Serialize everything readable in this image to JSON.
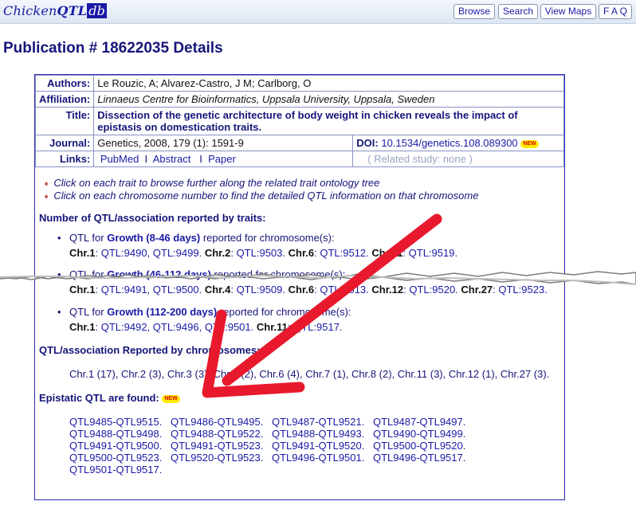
{
  "logo": {
    "part1": "Chicken",
    "part2": "QTL",
    "part3": "db"
  },
  "nav": {
    "browse": "Browse",
    "search": "Search",
    "view_maps": "View Maps",
    "faq": "F A Q"
  },
  "title": "Publication # 18622035 Details",
  "meta": {
    "authors_label": "Authors:",
    "authors": "Le Rouzic, A; Alvarez-Castro, J M; Carlborg, O",
    "affiliation_label": "Affiliation:",
    "affiliation": "Linnaeus Centre for Bioinformatics, Uppsala University, Uppsala, Sweden",
    "title_label": "Title:",
    "title_line1": "Dissection of the genetic architecture of body weight in chicken reveals the impact of",
    "title_line2": "epistasis on domestication traits.",
    "journal_label": "Journal:",
    "journal": "Genetics, 2008, 179 (1): 1591-9",
    "doi_label": "DOI:",
    "doi": "10.1534/genetics.108.089300",
    "links_label": "Links:",
    "pubmed": "PubMed",
    "abstract": "Abstract",
    "paper": "Paper",
    "sep": "I",
    "related": "( Related study: none )",
    "new": "NEW"
  },
  "notes": [
    "Click on each trait to browse further along the related trait ontology tree",
    "Click on each chromosome number to find the detailed QTL information on that chromosome"
  ],
  "traits_heading": "Number of QTL/association reported by traits:",
  "traits": [
    {
      "prefix": "QTL for ",
      "trait": "Growth (8-46 days)",
      "suffix": " reported for chromosome(s):",
      "line": [
        [
          "Chr.1",
          ": QTL:9490, QTL:9499. "
        ],
        [
          "Chr.2",
          ": QTL:9503. "
        ],
        [
          "Chr.6",
          ": QTL:9512. "
        ],
        [
          "Chr.11",
          ": QTL:9519."
        ]
      ]
    },
    {
      "prefix": "QTL for ",
      "trait": "Growth (46-112 days)",
      "suffix": " reported for chromosome(s):",
      "line": [
        [
          "Chr.1",
          ": QTL:9491, QTL:9500. "
        ],
        [
          "Chr.4",
          ": QTL:9509. "
        ],
        [
          "Chr.6",
          ": QTL:9513. "
        ],
        [
          "Chr.12",
          ": QTL:9520. "
        ],
        [
          "Chr.27",
          ": QTL:9523."
        ]
      ]
    },
    {
      "prefix": "QTL for ",
      "trait": "Growth (112-200 days)",
      "suffix": " reported for chromosome(s):",
      "line": [
        [
          "Chr.1",
          ": QTL:9492, QTL:9496, QTL:9501. "
        ],
        [
          "Chr.11",
          ": QTL:9517."
        ]
      ]
    }
  ],
  "chrom_heading": "QTL/association Reported by chromosomes:",
  "chromosomes": "Chr.1 (17), Chr.2 (3), Chr.3 (3), Chr.4 (2), Chr.6 (4), Chr.7 (1), Chr.8 (2), Chr.11 (3), Chr.12 (1), Chr.27 (3).",
  "epistatic_heading": "Epistatic QTL are found:",
  "epistatic_rows": [
    [
      "QTL9485-QTL9515.",
      "QTL9486-QTL9495.",
      "QTL9487-QTL9521.",
      "QTL9487-QTL9497."
    ],
    [
      "QTL9488-QTL9498.",
      "QTL9488-QTL9522.",
      "QTL9488-QTL9493.",
      "QTL9490-QTL9499."
    ],
    [
      "QTL9491-QTL9500.",
      "QTL9491-QTL9523.",
      "QTL9491-QTL9520.",
      "QTL9500-QTL9520."
    ],
    [
      "QTL9500-QTL9523.",
      "QTL9520-QTL9523.",
      "QTL9496-QTL9501.",
      "QTL9496-QTL9517."
    ],
    [
      "QTL9501-QTL9517."
    ]
  ],
  "colors": {
    "link": "#1a1aa6",
    "heading": "#15157a",
    "arrow": "#e8192c",
    "badge": "#ffeb00"
  }
}
